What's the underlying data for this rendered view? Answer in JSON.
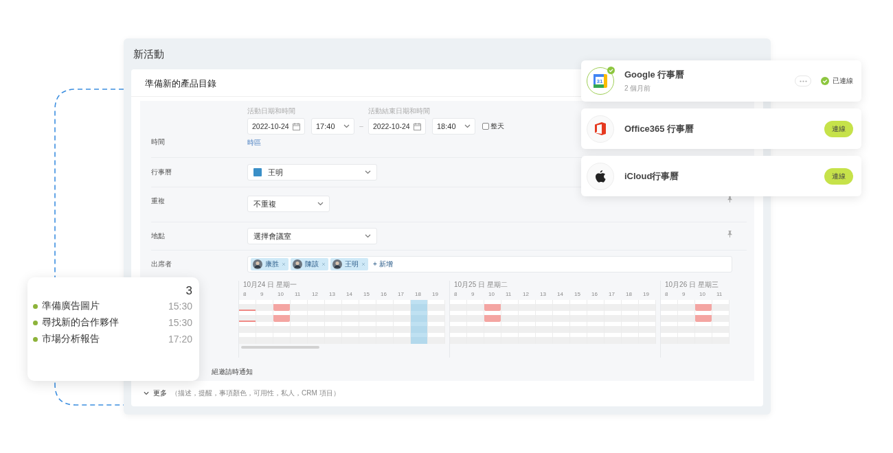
{
  "window": {
    "title": "新活動"
  },
  "event": {
    "title": "準備新的產品目錄"
  },
  "form": {
    "time": {
      "label": "時間",
      "start_label": "活動日期和時間",
      "start_date": "2022-10-24",
      "start_time": "17:40",
      "separator": "–",
      "end_label": "活動結束日期和時間",
      "end_date": "2022-10-24",
      "end_time": "18:40",
      "all_day": {
        "label": "整天",
        "checked": false
      },
      "timezone_link": "時區"
    },
    "calendar": {
      "label": "行事曆",
      "value": "王明",
      "color": "#3a8fc7"
    },
    "repeat": {
      "label": "重複",
      "value": "不重複"
    },
    "location": {
      "label": "地點",
      "value": "選擇會議室"
    },
    "attendees": {
      "label": "出席者",
      "people": [
        {
          "name": "康胜"
        },
        {
          "name": "陳該"
        },
        {
          "name": "王明"
        }
      ],
      "add_label": "+ 新增"
    },
    "schedule": {
      "days": [
        {
          "label": "10月24 日 星期一",
          "carry_in": [
            true,
            true,
            false,
            false
          ],
          "hours": [
            {
              "label": "8",
              "selected": false,
              "busy": [
                false,
                false,
                false,
                false
              ]
            },
            {
              "label": "9",
              "selected": false,
              "busy": [
                false,
                false,
                false,
                false
              ]
            },
            {
              "label": "10",
              "selected": false,
              "busy": [
                true,
                true,
                false,
                false
              ]
            },
            {
              "label": "11",
              "selected": false,
              "busy": [
                false,
                false,
                false,
                false
              ]
            },
            {
              "label": "12",
              "selected": false,
              "busy": [
                false,
                false,
                false,
                false
              ]
            },
            {
              "label": "13",
              "selected": false,
              "busy": [
                false,
                false,
                false,
                false
              ]
            },
            {
              "label": "14",
              "selected": false,
              "busy": [
                false,
                false,
                false,
                false
              ]
            },
            {
              "label": "15",
              "selected": false,
              "busy": [
                false,
                false,
                false,
                false
              ]
            },
            {
              "label": "16",
              "selected": false,
              "busy": [
                false,
                false,
                false,
                false
              ]
            },
            {
              "label": "17",
              "selected": false,
              "busy": [
                false,
                false,
                false,
                false
              ]
            },
            {
              "label": "18",
              "selected": true,
              "busy": [
                false,
                false,
                false,
                false
              ]
            },
            {
              "label": "19",
              "selected": false,
              "busy": [
                false,
                false,
                false,
                false
              ]
            }
          ]
        },
        {
          "label": "10月25 日 星期二",
          "carry_in": [
            false,
            false,
            false,
            false
          ],
          "hours": [
            {
              "label": "8",
              "selected": false,
              "busy": [
                false,
                false,
                false,
                false
              ]
            },
            {
              "label": "9",
              "selected": false,
              "busy": [
                false,
                false,
                false,
                false
              ]
            },
            {
              "label": "10",
              "selected": false,
              "busy": [
                true,
                true,
                false,
                false
              ]
            },
            {
              "label": "11",
              "selected": false,
              "busy": [
                false,
                false,
                false,
                false
              ]
            },
            {
              "label": "12",
              "selected": false,
              "busy": [
                false,
                false,
                false,
                false
              ]
            },
            {
              "label": "13",
              "selected": false,
              "busy": [
                false,
                false,
                false,
                false
              ]
            },
            {
              "label": "14",
              "selected": false,
              "busy": [
                false,
                false,
                false,
                false
              ]
            },
            {
              "label": "15",
              "selected": false,
              "busy": [
                false,
                false,
                false,
                false
              ]
            },
            {
              "label": "16",
              "selected": false,
              "busy": [
                false,
                false,
                false,
                false
              ]
            },
            {
              "label": "17",
              "selected": false,
              "busy": [
                false,
                false,
                false,
                false
              ]
            },
            {
              "label": "18",
              "selected": false,
              "busy": [
                false,
                false,
                false,
                false
              ]
            },
            {
              "label": "19",
              "selected": false,
              "busy": [
                false,
                false,
                false,
                false
              ]
            }
          ]
        },
        {
          "label": "10月26 日 星期三",
          "carry_in": [
            false,
            false,
            false,
            false
          ],
          "hours": [
            {
              "label": "8",
              "selected": false,
              "busy": [
                false,
                false,
                false,
                false
              ]
            },
            {
              "label": "9",
              "selected": false,
              "busy": [
                false,
                false,
                false,
                false
              ]
            },
            {
              "label": "10",
              "selected": false,
              "busy": [
                true,
                true,
                false,
                false
              ]
            },
            {
              "label": "11",
              "selected": false,
              "busy": [
                false,
                false,
                false,
                false
              ]
            }
          ]
        }
      ]
    },
    "notify_text": "絕邀請時通知",
    "more": {
      "label": "更多",
      "detail": "（描述，提醒，事項顏色，可用性，私人，CRM 項目）"
    }
  },
  "tasks": {
    "count": "3",
    "items": [
      {
        "title": "準備廣告圖片",
        "time": "15:30",
        "color": "#8db33a"
      },
      {
        "title": "尋找新的合作夥伴",
        "time": "15:30",
        "color": "#8db33a"
      },
      {
        "title": "市場分析報告",
        "time": "17:20",
        "color": "#8db33a"
      }
    ]
  },
  "integrations": [
    {
      "kind": "google",
      "name": "Google 行事曆",
      "subtitle": "2 個月前",
      "icon_text": "31",
      "connected": true,
      "status": "已連線"
    },
    {
      "kind": "office",
      "name": "Office365 行事曆",
      "connected": false,
      "status": "連線"
    },
    {
      "kind": "apple",
      "name": "iCloud行事曆",
      "connected": false,
      "status": "連線"
    }
  ]
}
